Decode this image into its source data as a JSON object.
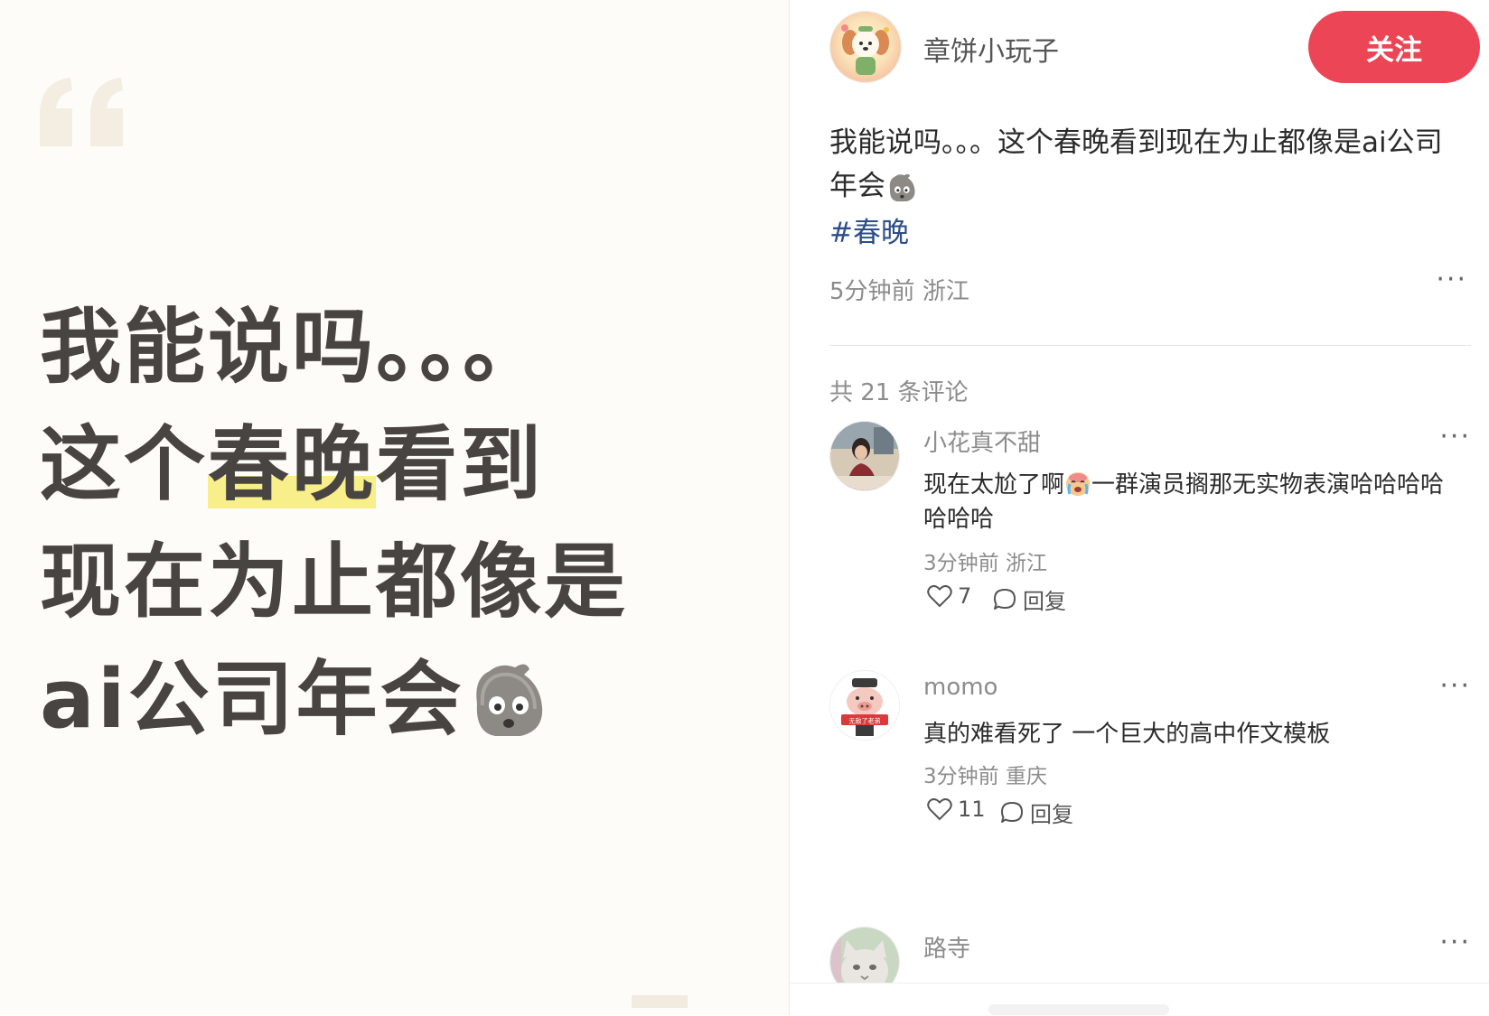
{
  "image_card": {
    "lines": [
      {
        "before": "我能说吗。。。",
        "highlight": "",
        "after": ""
      },
      {
        "before": "这个",
        "highlight": "春晚",
        "after": "看到"
      },
      {
        "before": "现在为止都像是",
        "highlight": "",
        "after": ""
      },
      {
        "before": "ai公司年会",
        "highlight": "",
        "after": ""
      }
    ],
    "emoji": "rock-face-emoji",
    "highlight_color": "#f8ee8a"
  },
  "author": {
    "name": "章饼小玩子",
    "follow_label": "关注",
    "follow_color": "#ec4555"
  },
  "post": {
    "text": "我能说吗。。。这个春晚看到现在为止都像是ai公司年会",
    "hashtag": "#春晚",
    "time": "5分钟前",
    "location": "浙江",
    "more": "···"
  },
  "comments_header": "共 21 条评论",
  "comments": [
    {
      "name": "小花真不甜",
      "text_part1": "现在太尬了啊",
      "text_part2": "一群演员搁那无实物表演哈哈哈哈哈哈哈",
      "time": "3分钟前",
      "location": "浙江",
      "likes": "7",
      "reply_label": "回复",
      "more": "···"
    },
    {
      "name": "momo",
      "avatar_badge": "无敌了老弟",
      "text_part1": "真的难看死了 一个巨大的高中作文模板",
      "text_part2": "",
      "time": "3分钟前",
      "location": "重庆",
      "likes": "11",
      "reply_label": "回复",
      "more": "···"
    },
    {
      "name": "路寺",
      "text_part1": "",
      "text_part2": "",
      "more": "···"
    }
  ]
}
